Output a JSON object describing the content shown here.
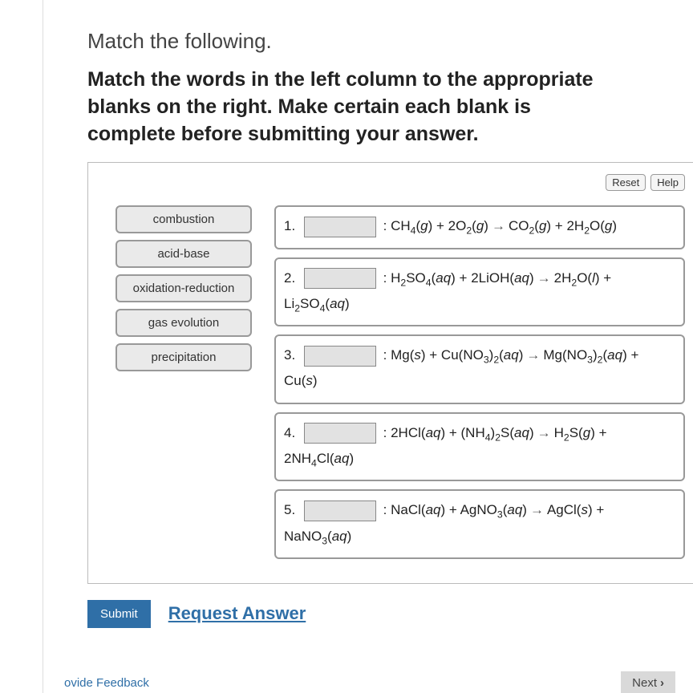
{
  "title": "Match the following.",
  "instruction": "Match the words in the left column to the appropriate blanks on the right. Make certain each blank is complete before submitting your answer.",
  "controls": {
    "reset": "Reset",
    "help": "Help"
  },
  "tags": [
    "combustion",
    "acid-base",
    "oxidation-reduction",
    "gas evolution",
    "precipitation"
  ],
  "equations": {
    "1": {
      "num": "1."
    },
    "2": {
      "num": "2."
    },
    "3": {
      "num": "3."
    },
    "4": {
      "num": "4."
    },
    "5": {
      "num": "5."
    }
  },
  "actions": {
    "submit": "Submit",
    "request": "Request Answer"
  },
  "footer": {
    "feedback": "ovide Feedback",
    "next": "Next"
  }
}
